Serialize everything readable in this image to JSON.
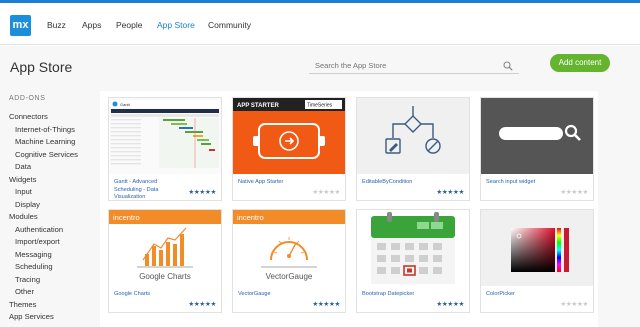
{
  "nav": {
    "logo": "mx",
    "links": [
      {
        "label": "Buzz"
      },
      {
        "label": "Apps"
      },
      {
        "label": "People"
      },
      {
        "label": "App Store"
      },
      {
        "label": "Community"
      }
    ],
    "active": "App Store"
  },
  "header": {
    "title": "App Store",
    "search_placeholder": "Search the App Store",
    "add_button": "Add content"
  },
  "sidebar": {
    "heading": "ADD-ONS",
    "items": [
      {
        "label": "Connectors",
        "level": 1
      },
      {
        "label": "Internet-of-Things",
        "level": 2
      },
      {
        "label": "Machine Learning",
        "level": 2
      },
      {
        "label": "Cognitive Services",
        "level": 2
      },
      {
        "label": "Data",
        "level": 2
      },
      {
        "label": "Widgets",
        "level": 1
      },
      {
        "label": "Input",
        "level": 2
      },
      {
        "label": "Display",
        "level": 2
      },
      {
        "label": "Modules",
        "level": 1
      },
      {
        "label": "Authentication",
        "level": 2
      },
      {
        "label": "Import/export",
        "level": 2
      },
      {
        "label": "Messaging",
        "level": 2
      },
      {
        "label": "Scheduling",
        "level": 2
      },
      {
        "label": "Tracing",
        "level": 2
      },
      {
        "label": "Other",
        "level": 2
      },
      {
        "label": "Themes",
        "level": 1
      },
      {
        "label": "App Services",
        "level": 1
      }
    ]
  },
  "cards": [
    {
      "name": "Gantt - Advanced Scheduling - Data Visualization",
      "stars": "★★★★★",
      "rated": true,
      "thumb_label": "Gantt"
    },
    {
      "name": "Native App Starter",
      "stars": "★★★★★",
      "rated": false,
      "thumb_label": "APP STARTER",
      "thumb_sub": "TimeSeries"
    },
    {
      "name": "EditableByCondition",
      "stars": "★★★★★",
      "rated": true
    },
    {
      "name": "Search input widget",
      "stars": "★★★★★",
      "rated": false
    },
    {
      "name": "Google Charts",
      "stars": "★★★★★",
      "rated": true,
      "thumb_label": "incentro",
      "thumb_sub": "Google Charts"
    },
    {
      "name": "VectorGauge",
      "stars": "★★★★★",
      "rated": true,
      "thumb_label": "incentro",
      "thumb_sub": "VectorGauge"
    },
    {
      "name": "Bootstrap Datepicker",
      "stars": "★★★★★",
      "rated": true
    },
    {
      "name": "ColorPicker",
      "stars": "★★★★★",
      "rated": false
    }
  ],
  "colors": {
    "accent": "#1a7fd4",
    "add_button": "#64b42d",
    "orange": "#f05a14",
    "star_on": "#2f5aa8",
    "star_off": "#c8c8c8"
  }
}
